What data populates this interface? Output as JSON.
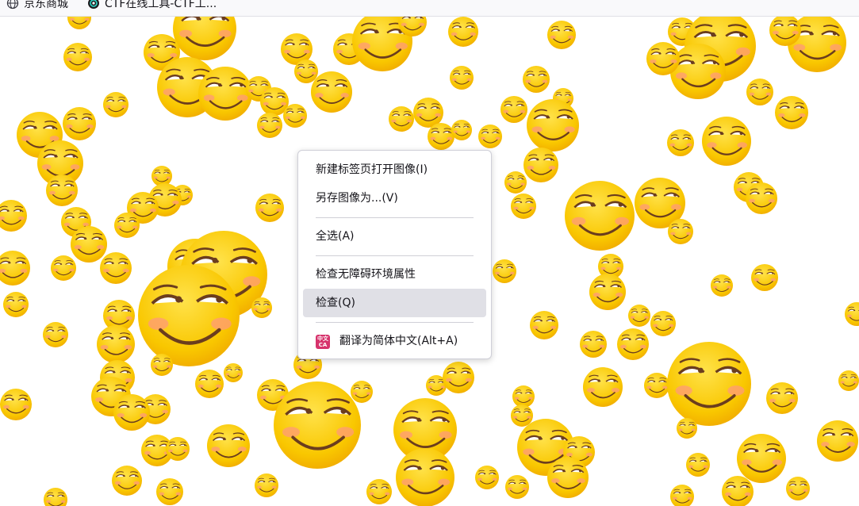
{
  "bookmarks": [
    {
      "label": "京东商城",
      "icon": "globe-icon"
    },
    {
      "label": "CTF在线工具-CTF工...",
      "icon": "ctf-tools-icon"
    }
  ],
  "context_menu": {
    "items": [
      {
        "label": "新建标签页打开图像(I)"
      },
      {
        "label": "另存图像为...(V)"
      },
      {
        "label": "全选(A)"
      },
      {
        "label": "检查无障碍环境属性"
      },
      {
        "label": "检查(Q)",
        "hovered": true
      },
      {
        "label": "翻译为简体中文(Alt+A)",
        "icon": "translate-icon"
      }
    ],
    "translate_badge": {
      "top": "中文",
      "bottom": "CA"
    }
  },
  "background": {
    "pattern": "repeated-smirk-emoji",
    "emoji_colors": {
      "face": "#f9c700",
      "face_light": "#ffe24a",
      "blush": "#ff9a7a",
      "outline": "#6b3d1e"
    }
  },
  "colors": {
    "menu_hover": "#e0e0e6",
    "menu_border": "#cfcfd8",
    "text": "#15141a"
  }
}
